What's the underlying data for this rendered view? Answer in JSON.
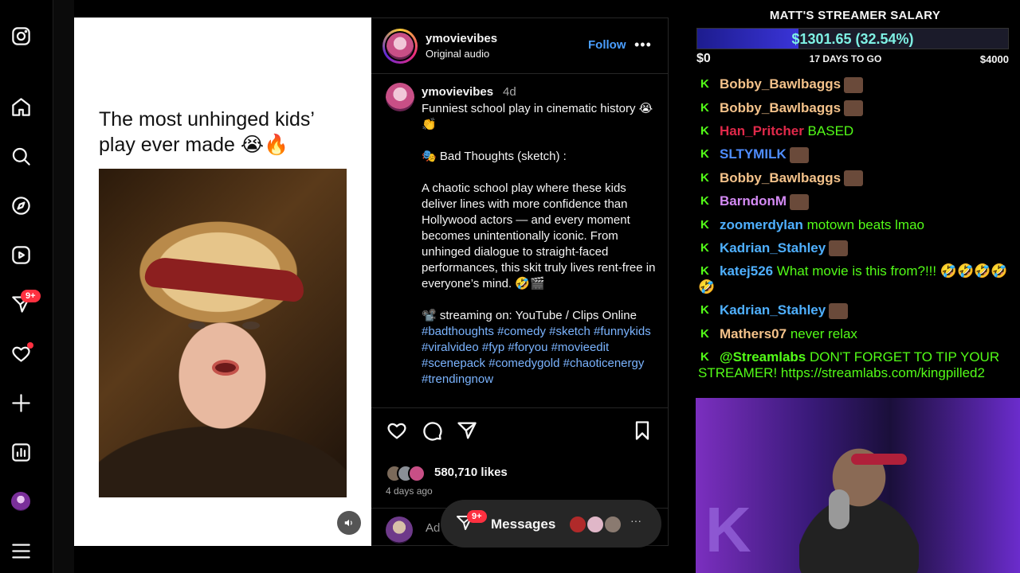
{
  "nav": {
    "items": [
      "instagram-logo",
      "home",
      "search",
      "explore",
      "reels",
      "messages",
      "notifications",
      "create",
      "dashboard",
      "profile",
      "more"
    ],
    "messages_badge": "9+"
  },
  "post": {
    "media_title": "The most unhinged kids’ play ever made 😭🔥",
    "username": "ymovievibes",
    "audio": "Original audio",
    "follow": "Follow",
    "more": "•••",
    "caption_user": "ymovievibes",
    "caption_time": "4d",
    "caption_text": "Funniest school play in cinematic history 😭👏\n\n🎭 Bad Thoughts (sketch) :\n\nA chaotic school play where these kids deliver lines with more confidence than Hollywood actors — and every moment becomes unintentionally iconic. From unhinged dialogue to straight-faced performances, this skit truly lives rent-free in everyone’s mind. 🤣🎬\n\n📽️ streaming on: YouTube / Clips Online\n",
    "hashtags": "#badthoughts #comedy #sketch #funnykids #viralvideo #fyp #foryou #movieedit #scenepack #comedygold #chaoticenergy #trendingnow",
    "likes": "580,710 likes",
    "ago": "4 days ago",
    "comment_placeholder": "Ad"
  },
  "messages": {
    "label": "Messages",
    "badge": "9+",
    "more": "···"
  },
  "overlay": {
    "goal_title": "MATT'S STREAMER SALARY",
    "goal_amount": "$1301.65 (32.54%)",
    "goal_progress": 0.3254,
    "goal_min": "$0",
    "goal_days": "17 DAYS TO GO",
    "goal_max": "$4000",
    "chat": [
      {
        "user": "Bobby_Bawlbaggs",
        "color": "#f4c28a",
        "msg": "",
        "emote": true
      },
      {
        "user": "Bobby_Bawlbaggs",
        "color": "#f4c28a",
        "msg": "",
        "emote": true
      },
      {
        "user": "Han_Pritcher",
        "color": "#e0294a",
        "msg": "BASED",
        "emote": false
      },
      {
        "user": "SLTYMILK",
        "color": "#4f8dff",
        "msg": "",
        "emote": true
      },
      {
        "user": "Bobby_Bawlbaggs",
        "color": "#f4c28a",
        "msg": "",
        "emote": true
      },
      {
        "user": "BarndonM",
        "color": "#d48af4",
        "msg": "",
        "emote": true
      },
      {
        "user": "zoomerdylan",
        "color": "#4fb0ff",
        "msg": "motown beats lmao",
        "emote": false
      },
      {
        "user": "Kadrian_Stahley",
        "color": "#4fb0ff",
        "msg": "",
        "emote": true
      },
      {
        "user": "katej526",
        "color": "#4fb0ff",
        "msg": "What movie is this from?!!! 🤣🤣🤣🤣🤣",
        "emote": false
      },
      {
        "user": "Kadrian_Stahley",
        "color": "#4fb0ff",
        "msg": "",
        "emote": true
      },
      {
        "user": "Mathers07",
        "color": "#f4c28a",
        "msg": "never relax",
        "emote": false
      },
      {
        "user": "@Streamlabs",
        "color": "#53fc18",
        "msg": "DON'T FORGET TO TIP YOUR STREAMER! https://streamlabs.com/kingpilled2",
        "emote": false
      }
    ]
  }
}
